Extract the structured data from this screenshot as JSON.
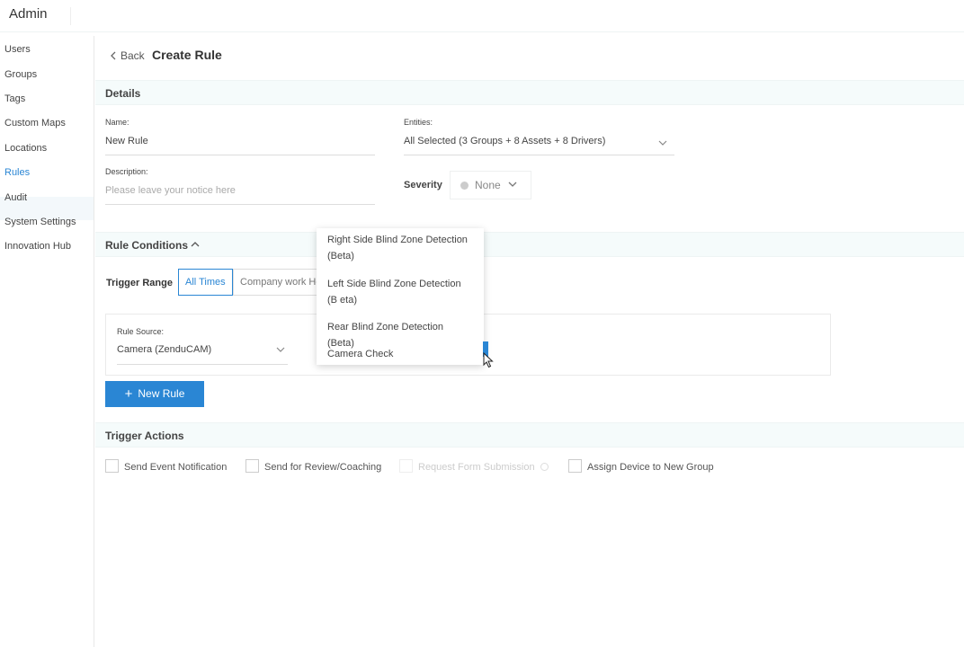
{
  "app": {
    "title": "Admin"
  },
  "sidebar": {
    "items": [
      {
        "label": "Users"
      },
      {
        "label": "Groups"
      },
      {
        "label": "Tags"
      },
      {
        "label": "Custom Maps"
      },
      {
        "label": "Locations"
      },
      {
        "label": "Rules"
      },
      {
        "label": "Audit"
      },
      {
        "label": "System Settings"
      },
      {
        "label": "Innovation Hub"
      }
    ],
    "active": "Rules"
  },
  "header": {
    "back_label": "Back",
    "title": "Create Rule"
  },
  "details": {
    "section_title": "Details",
    "name_label": "Name:",
    "name_value": "New Rule",
    "entities_label": "Entities:",
    "entities_value": "All Selected (3 Groups + 8 Assets + 8 Drivers)",
    "description_label": "Description:",
    "description_placeholder": "Please leave your notice here",
    "severity_label": "Severity",
    "severity_value": "None"
  },
  "conditions": {
    "section_title": "Rule Conditions",
    "trigger_range_label": "Trigger Range",
    "range_options": [
      "All Times",
      "Company work Ho"
    ],
    "rule_source_label": "Rule Source:",
    "rule_source_value": "Camera (ZenduCAM)",
    "new_rule_label": "New Rule"
  },
  "dropdown": {
    "items": [
      "Right Side Blind Zone Detection (Beta)",
      "Left Side Blind Zone Detection (B eta)",
      "Rear Blind Zone Detection (Beta)",
      "Camera Check"
    ]
  },
  "actions": {
    "section_title": "Trigger Actions",
    "checkboxes": [
      {
        "label": "Send Event Notification"
      },
      {
        "label": "Send for Review/Coaching"
      },
      {
        "label": "Request Form Submission"
      },
      {
        "label": "Assign Device to New Group"
      }
    ]
  },
  "colors": {
    "accent": "#2a86d4",
    "band": "#f5fbfb"
  }
}
